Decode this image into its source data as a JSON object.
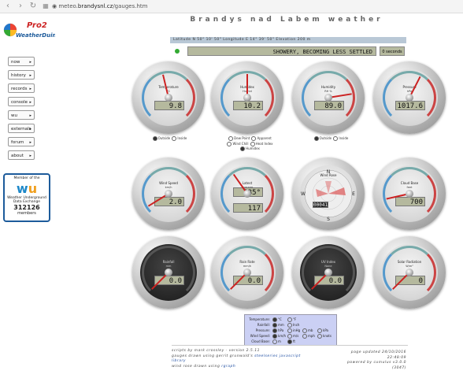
{
  "browser": {
    "url_prefix": "meteo.",
    "url_site": "brandysnl.cz",
    "url_path": "/gauges.htm"
  },
  "logo": {
    "line1": "Pro2",
    "line2": "WeatherDuino"
  },
  "menu": [
    {
      "label": "now"
    },
    {
      "label": "history"
    },
    {
      "label": "records"
    },
    {
      "label": "console"
    },
    {
      "label": "wu"
    },
    {
      "label": "externals"
    },
    {
      "label": "forum"
    },
    {
      "label": "about"
    }
  ],
  "wu_badge": {
    "line1": "Member of the",
    "logo": "wu",
    "line2": "Weather Underground",
    "line3": "Data Exchange",
    "count": "312126",
    "line4": "members"
  },
  "header": {
    "title": "Brandys nad Labem weather",
    "location": "Latitude N 50° 10' 50\"   Longitude E 14° 39' 50\"   Elevation 200 m",
    "forecast": "SHOWERY, BECOMING LESS SETTLED",
    "forecast_small": "0 seconds"
  },
  "gauges": [
    {
      "title": "Temperature",
      "unit": "°C",
      "value": "9.8",
      "needle": 0.45,
      "dark": false
    },
    {
      "title": "Humidex",
      "unit": "Humid",
      "value": "10.2",
      "needle": 0.5,
      "dark": false
    },
    {
      "title": "Humidity",
      "unit": "RH %",
      "value": "89.0",
      "needle": 0.8,
      "dark": false
    },
    {
      "title": "Pressure",
      "unit": "hPa",
      "value": "1017.6",
      "needle": 0.6,
      "dark": false
    },
    {
      "title": "Wind Speed",
      "unit": "km/h",
      "value": "2.0",
      "needle": 0.05,
      "dark": false
    },
    {
      "title": "Latest",
      "unit": "Average",
      "value": "135°",
      "value2": "117",
      "needle": 0.37,
      "dark": false
    },
    {
      "title": "Wind Rose",
      "unit": "",
      "value": "00041",
      "needle": 0,
      "dark": false
    },
    {
      "title": "Cloud Base",
      "unit": "feet",
      "value": "700",
      "needle": 0.12,
      "dark": false
    },
    {
      "title": "Rainfall",
      "unit": "mm",
      "value": "0.0",
      "needle": 0,
      "dark": true
    },
    {
      "title": "Rain Rate",
      "unit": "mm/h",
      "value": "0.0",
      "needle": 0,
      "dark": false
    },
    {
      "title": "UV Index",
      "unit": "None",
      "value": "0.0",
      "needle": 0,
      "dark": true
    },
    {
      "title": "Solar Radiation",
      "unit": "W/m²",
      "value": "0",
      "needle": 0,
      "dark": false
    }
  ],
  "compass": {
    "n": "N",
    "s": "S",
    "e": "E",
    "w": "W"
  },
  "radios": {
    "temp": {
      "outside": "Outside",
      "inside": "Inside"
    },
    "dew": {
      "dew_point": "Dew Point",
      "apparent": "Apparent",
      "wind_chill": "Wind Chill",
      "heat_index": "Heat Index",
      "humidex": "Humidex"
    },
    "hum": {
      "outside": "Outside",
      "inside": "Inside"
    }
  },
  "units": [
    {
      "label": "Temperature:",
      "options": [
        "°C",
        "°F"
      ],
      "selected": 0
    },
    {
      "label": "Rainfall:",
      "options": [
        "mm",
        "Inch"
      ],
      "selected": 0
    },
    {
      "label": "Pressure:",
      "options": [
        "hPa",
        "inHg",
        "mb",
        "kPa"
      ],
      "selected": 0
    },
    {
      "label": "Wind Speed:",
      "options": [
        "km/h",
        "m/s",
        "mph",
        "knots"
      ],
      "selected": 0
    },
    {
      "label": "Cloud Base:",
      "options": [
        "m",
        "ft"
      ],
      "selected": 1
    }
  ],
  "footer": {
    "left1": "scripts by mark crossley - version 2.5.11",
    "left2a": "gauges drawn using gerrit grunwald's ",
    "left2b": "steelseries",
    "left2c": " javascript",
    "left3": "library",
    "left4a": "wind rose drawn using ",
    "left4b": "rgraph",
    "right1": "page updated 24/10/2016",
    "right2": "22:48:09",
    "right3": "powered by cumulus v3.0.0",
    "right4": "(3047)"
  }
}
